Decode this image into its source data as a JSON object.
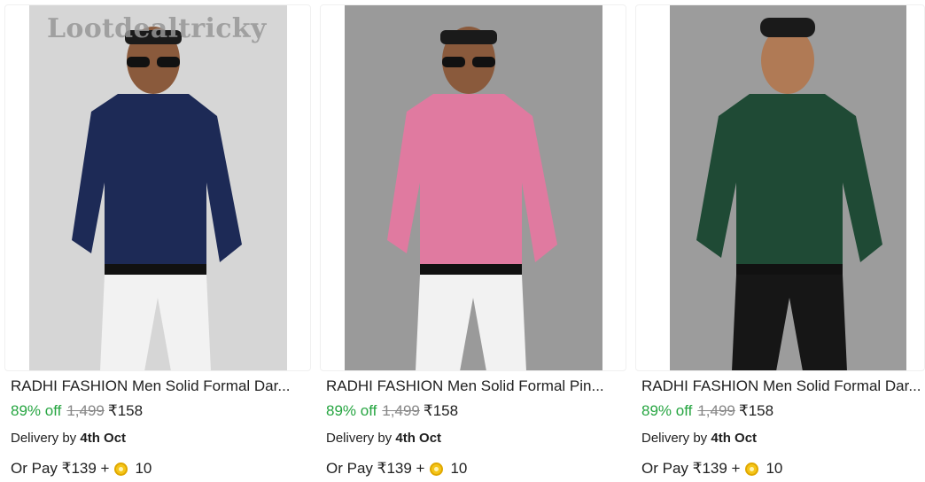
{
  "watermark": "Lootdealtricky",
  "products": [
    {
      "title": "RADHI FASHION Men Solid Formal Dar...",
      "discount": "89% off",
      "mrp": "1,499",
      "price": "₹158",
      "delivery_prefix": "Delivery by",
      "delivery_date": "4th Oct",
      "pay_text": "Or Pay ₹139 +",
      "coins": "10",
      "shirt_color": "#1d2a56",
      "pants_color": "#f2f2f2",
      "bg_color": "#d6d6d6"
    },
    {
      "title": "RADHI FASHION Men Solid Formal Pin...",
      "discount": "89% off",
      "mrp": "1,499",
      "price": "₹158",
      "delivery_prefix": "Delivery by",
      "delivery_date": "4th Oct",
      "pay_text": "Or Pay ₹139 +",
      "coins": "10",
      "shirt_color": "#e07aa0",
      "pants_color": "#f2f2f2",
      "bg_color": "#9a9a9a"
    },
    {
      "title": "RADHI FASHION Men Solid Formal Dar...",
      "discount": "89% off",
      "mrp": "1,499",
      "price": "₹158",
      "delivery_prefix": "Delivery by",
      "delivery_date": "4th Oct",
      "pay_text": "Or Pay ₹139 +",
      "coins": "10",
      "shirt_color": "#1f4a35",
      "pants_color": "#161616",
      "bg_color": "#9c9c9c"
    }
  ]
}
